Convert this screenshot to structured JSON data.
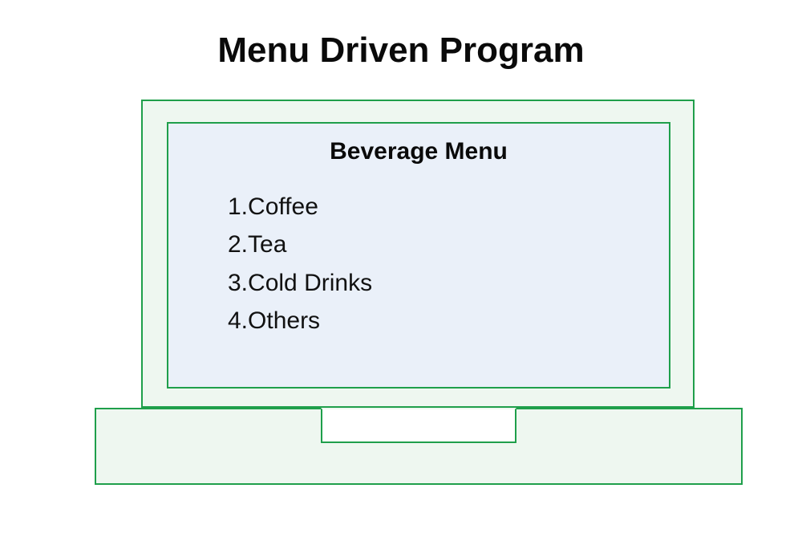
{
  "title": "Menu Driven Program",
  "menu": {
    "heading": "Beverage Menu",
    "items": [
      {
        "num": "1.",
        "label": "Coffee"
      },
      {
        "num": "2.",
        "label": "Tea"
      },
      {
        "num": "3.",
        "label": "Cold Drinks"
      },
      {
        "num": "4.",
        "label": "Others"
      }
    ]
  }
}
